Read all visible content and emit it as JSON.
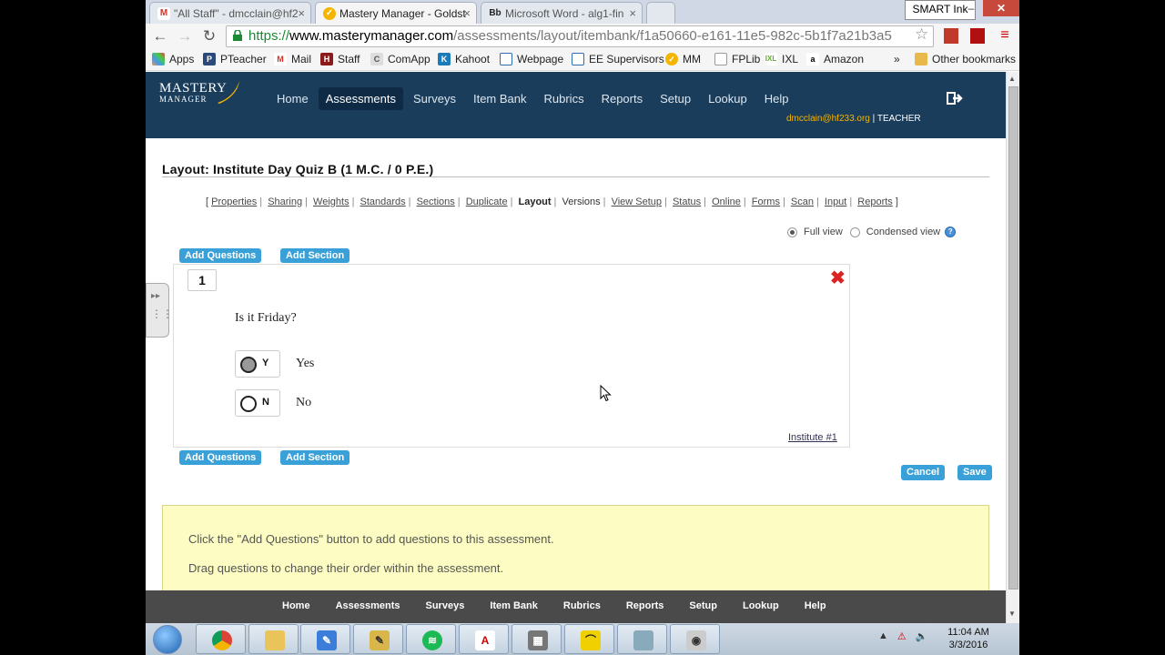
{
  "browser": {
    "tabs": [
      {
        "label": "\"All Staff\" - dmcclain@hf2",
        "icon": "gmail-icon"
      },
      {
        "label": "Mastery Manager - Goldst",
        "icon": "mastery-manager-icon"
      },
      {
        "label": "Microsoft Word - alg1-fin",
        "icon": "blackboard-icon"
      }
    ],
    "smart_ink_label": "SMART Ink",
    "url_scheme": "https://",
    "url_host": "www.masterymanager.com",
    "url_path": "/assessments/layout/itembank/f1a50660-e161-11e5-982c-5b1f7a21b3a5",
    "bookmarks": [
      "Apps",
      "PTeacher",
      "Mail",
      "Staff",
      "ComApp",
      "Kahoot",
      "Webpage",
      "EE Supervisors",
      "MM",
      "FPLib",
      "IXL",
      "Amazon"
    ],
    "bookmarks_overflow": "»",
    "other_bookmarks": "Other bookmarks"
  },
  "app": {
    "logo_line1": "MASTERY",
    "logo_line2": "MANAGER",
    "nav": [
      "Home",
      "Assessments",
      "Surveys",
      "Item Bank",
      "Rubrics",
      "Reports",
      "Setup",
      "Lookup",
      "Help"
    ],
    "active_nav": "Assessments",
    "user_email": "dmcclain@hf233.org",
    "user_role": " | TEACHER"
  },
  "page": {
    "title": "Layout: Institute Day Quiz B (1 M.C. / 0 P.E.)",
    "subnav": {
      "open": "[",
      "close": "]",
      "links": [
        "Properties",
        "Sharing",
        "Weights",
        "Standards",
        "Sections",
        "Duplicate",
        "Layout",
        "Versions",
        "View Setup",
        "Status",
        "Online",
        "Forms",
        "Scan",
        "Input",
        "Reports"
      ],
      "current": "Layout",
      "plain": "Versions"
    },
    "view_full": "Full view",
    "view_condensed": "Condensed view",
    "add_questions": "Add Questions",
    "add_section": "Add Section",
    "question": {
      "number": "1",
      "text": "Is it Friday?",
      "choices": [
        {
          "letter": "Y",
          "answer": "Yes",
          "selected": true
        },
        {
          "letter": "N",
          "answer": "No",
          "selected": false
        }
      ],
      "source_link": "Institute #1"
    },
    "cancel": "Cancel",
    "save": "Save",
    "info_lines": [
      "Click the \"Add Questions\" button to add questions to this assessment.",
      "Drag questions to change their order within the assessment."
    ]
  },
  "footer_nav": [
    "Home",
    "Assessments",
    "Surveys",
    "Item Bank",
    "Rubrics",
    "Reports",
    "Setup",
    "Lookup",
    "Help"
  ],
  "taskbar": {
    "apps": [
      "chrome-icon",
      "file-explorer-icon",
      "notebook-icon",
      "smart-notebook-icon",
      "spotify-icon",
      "acrobat-icon",
      "calculator-icon",
      "geogebra-icon",
      "paint-icon",
      "camera-icon"
    ],
    "time": "11:04 AM",
    "date": "3/3/2016"
  },
  "colors": {
    "header_bg": "#1a3d5c",
    "accent_button": "#3aa0d8",
    "info_bg": "#fdfdc3",
    "email": "#f4b400"
  }
}
